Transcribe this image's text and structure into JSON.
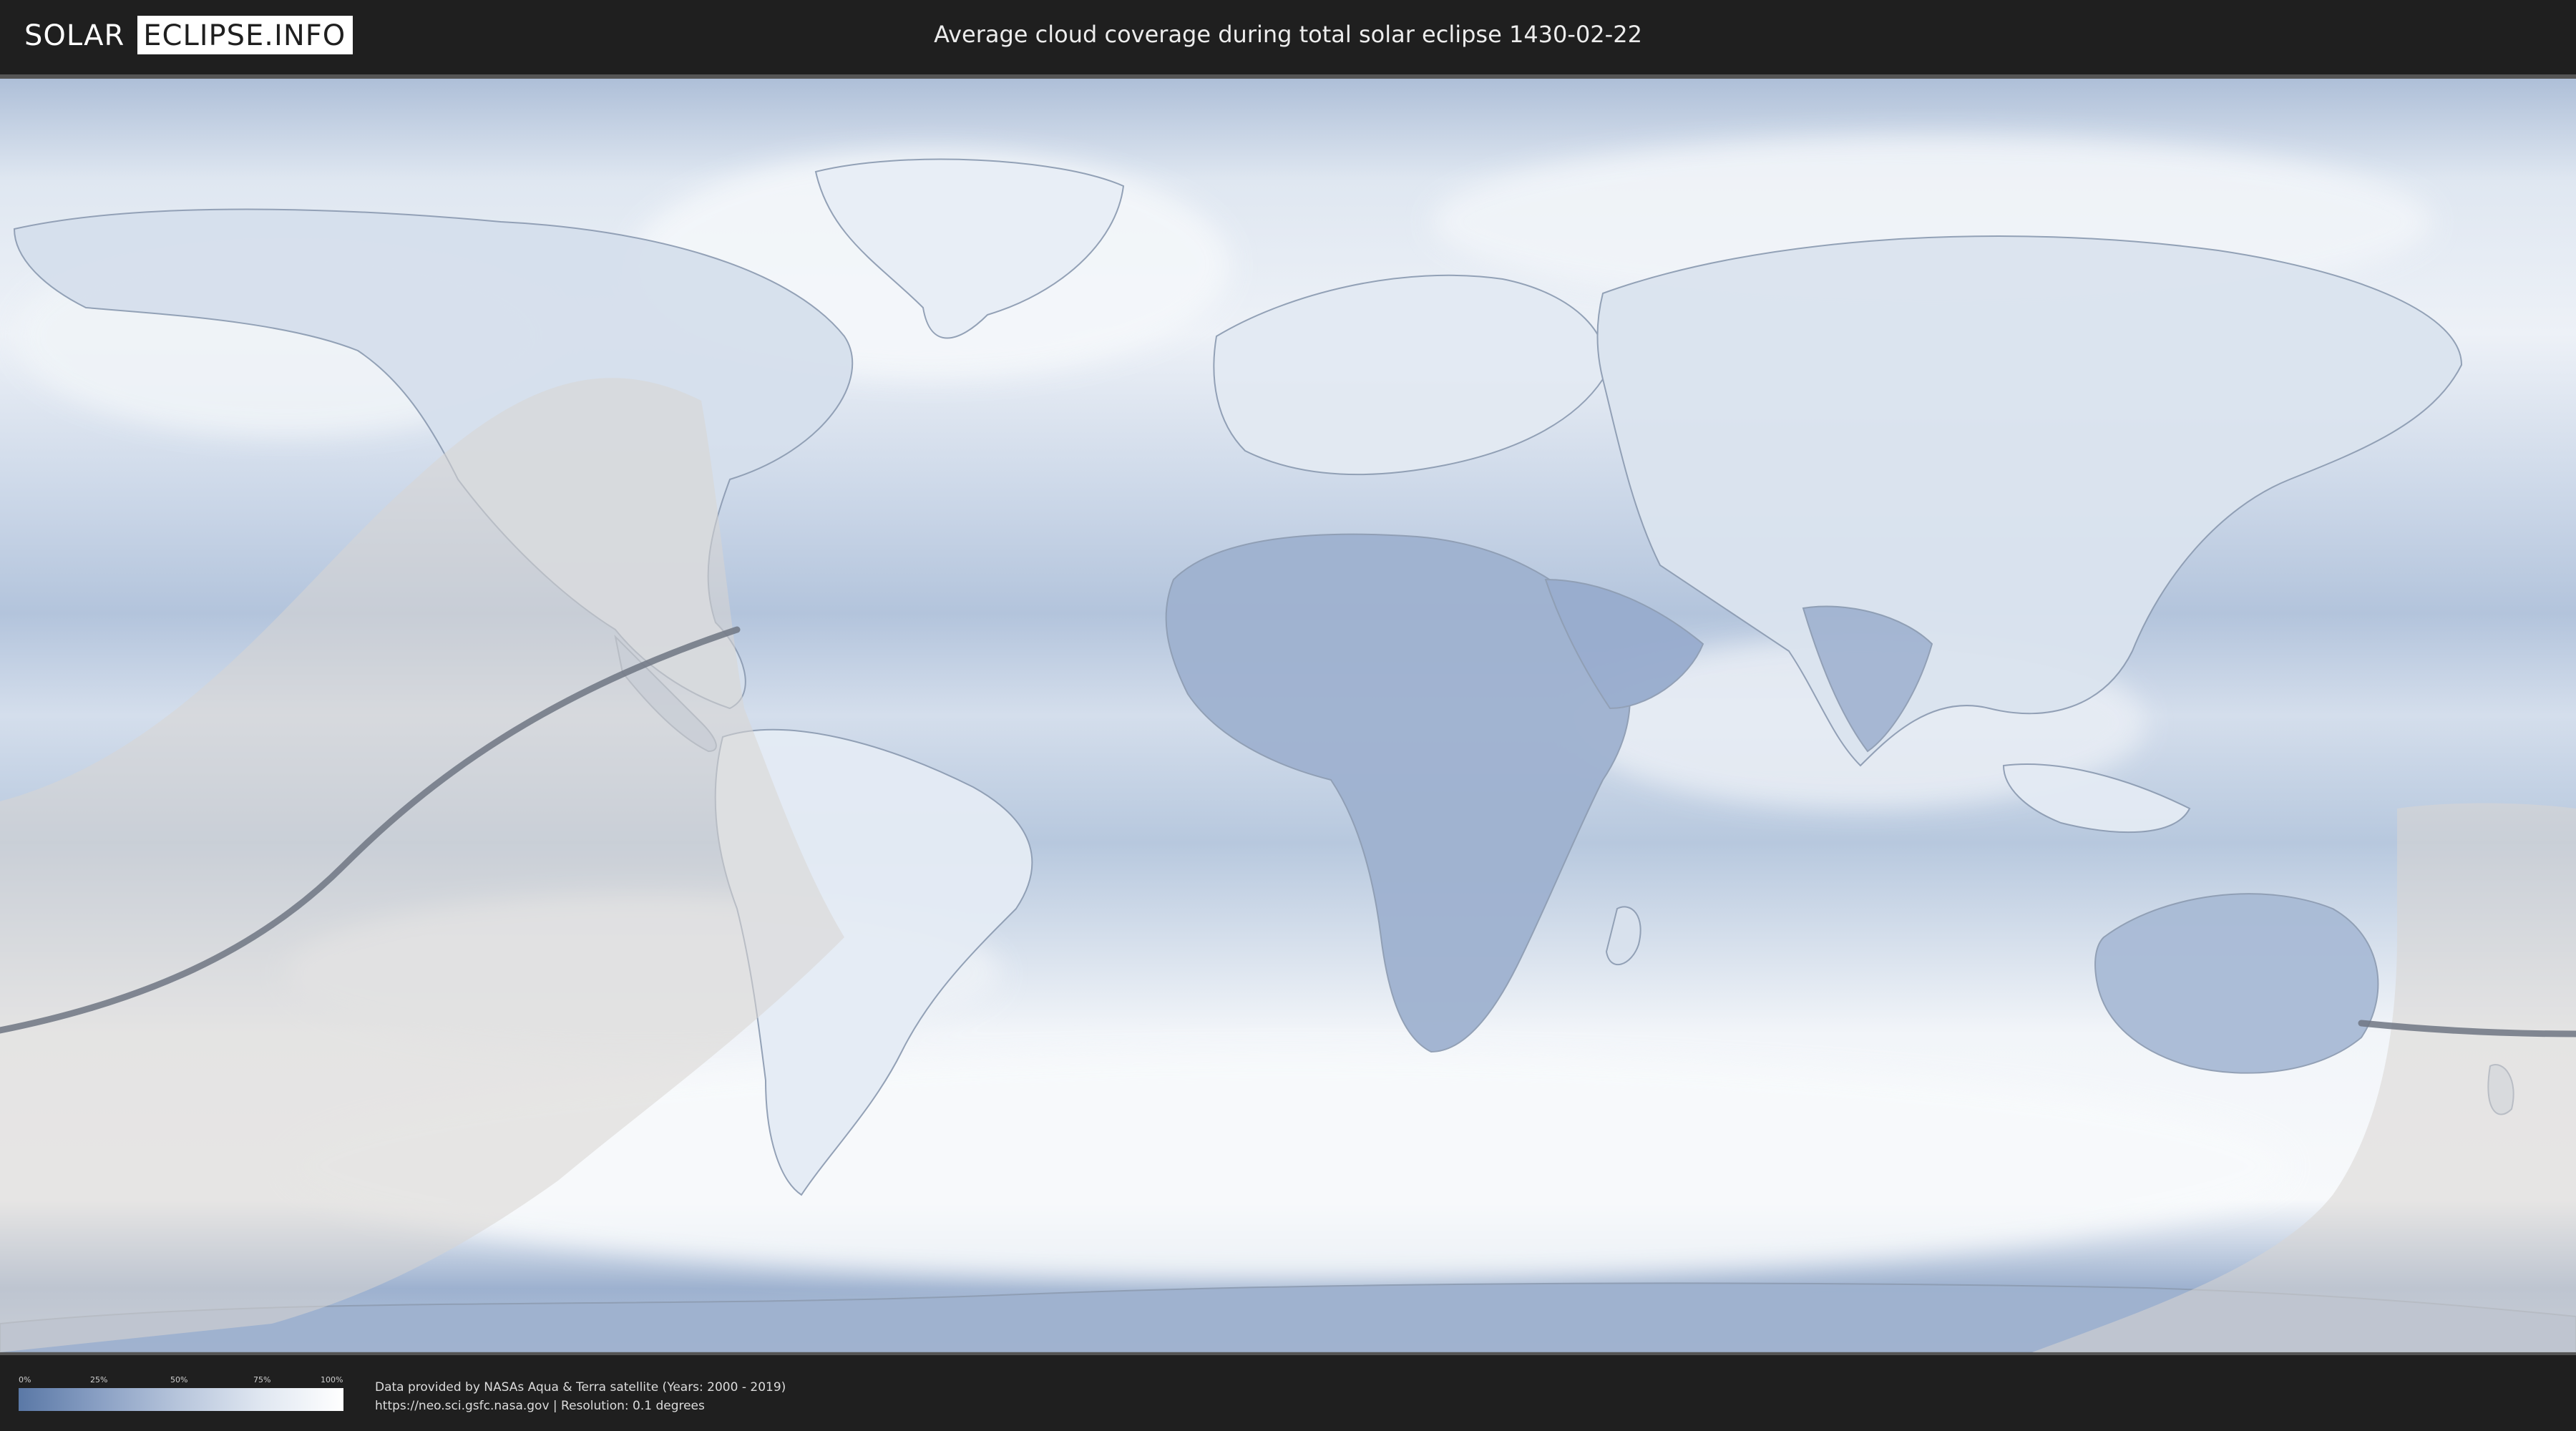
{
  "header": {
    "logo_left": "SOLAR",
    "logo_right": "ECLIPSE.INFO",
    "title": "Average cloud coverage during total solar eclipse 1430-02-22"
  },
  "legend": {
    "ticks": [
      "0%",
      "25%",
      "50%",
      "75%",
      "100%"
    ],
    "colors": {
      "low": "#5a78a6",
      "high": "#ffffff"
    }
  },
  "credits": {
    "line1": "Data provided by NASAs Aqua & Terra satellite (Years: 2000 - 2019)",
    "line2": "https://neo.sci.gsfc.nasa.gov | Resolution: 0.1 degrees"
  },
  "colors": {
    "ocean": "#c9d6e8",
    "cloud": "#f3f6fa",
    "land_dry": "#7f97bf",
    "eclipse_shade": "#d9d6d2",
    "central_line": "#6e7682"
  }
}
